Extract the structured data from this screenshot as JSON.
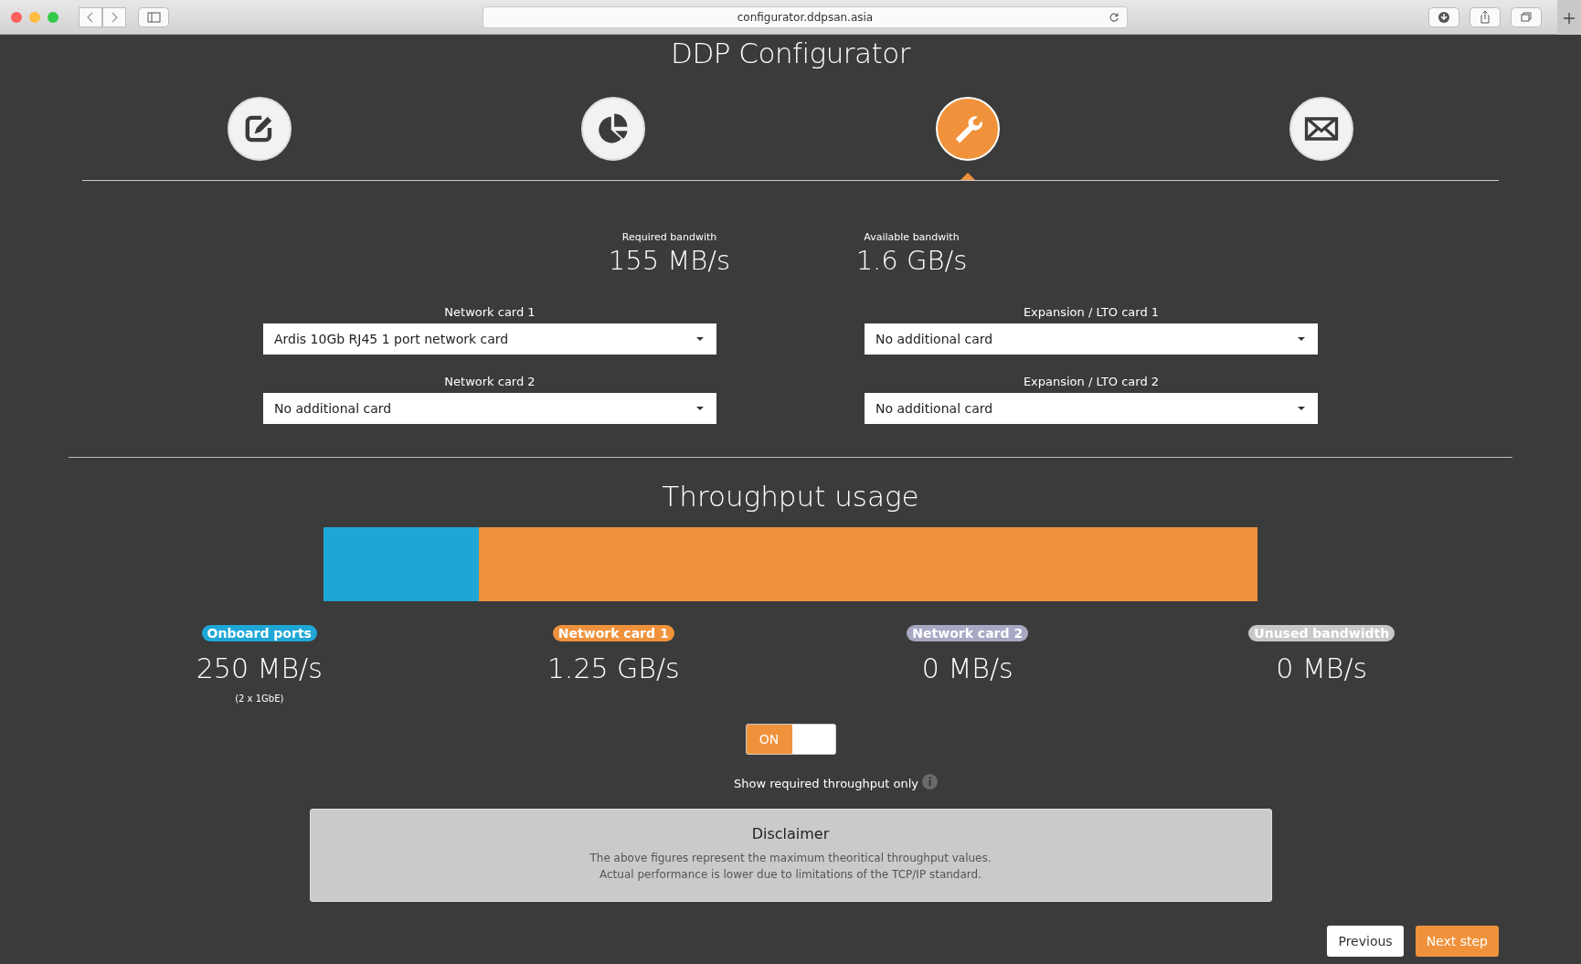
{
  "browser": {
    "url": "configurator.ddpsan.asia"
  },
  "title": "DDP Configurator",
  "steps": [
    {
      "kind": "edit",
      "selected": false
    },
    {
      "kind": "chart",
      "selected": false
    },
    {
      "kind": "wrench",
      "selected": true
    },
    {
      "kind": "mail",
      "selected": false
    }
  ],
  "bandwidth": [
    {
      "label": "Required bandwith",
      "value": "155 MB/s"
    },
    {
      "label": "Available bandwith",
      "value": "1.6 GB/s"
    }
  ],
  "cards": [
    {
      "label": "Network card 1",
      "value": "Ardis 10Gb RJ45 1 port network card"
    },
    {
      "label": "Expansion / LTO card 1",
      "value": "No additional card"
    },
    {
      "label": "Network card 2",
      "value": "No additional card"
    },
    {
      "label": "Expansion / LTO card 2",
      "value": "No additional card"
    }
  ],
  "throughput": {
    "title": "Throughput usage",
    "segments": [
      {
        "label": "Onboard ports",
        "color": "#1ea7d6",
        "level": 0.167,
        "value": "250 MB/s",
        "note": "(2 x 1GbE)"
      },
      {
        "label": "Network card 1",
        "color": "#f0923b",
        "level": 0.833,
        "value": "1.25 GB/s"
      },
      {
        "label": "Network card 2",
        "color": "#a8a8c4",
        "value": "0 MB/s"
      },
      {
        "label": "Unused bandwidth",
        "color": "#c8c8c8",
        "value": "0 MB/s"
      }
    ]
  },
  "toggle": {
    "on": true,
    "label": "ON",
    "caption": "Show required throughput only"
  },
  "disclaimer": {
    "title": "Disclaimer",
    "lines": [
      "The above figures represent the maximum theoritical throughput values.",
      "Actual performance is lower due to limitations of the TCP/IP standard."
    ]
  },
  "buttons": [
    {
      "label": "Previous",
      "kind": "secondary"
    },
    {
      "label": "Next step",
      "kind": "primary"
    }
  ]
}
